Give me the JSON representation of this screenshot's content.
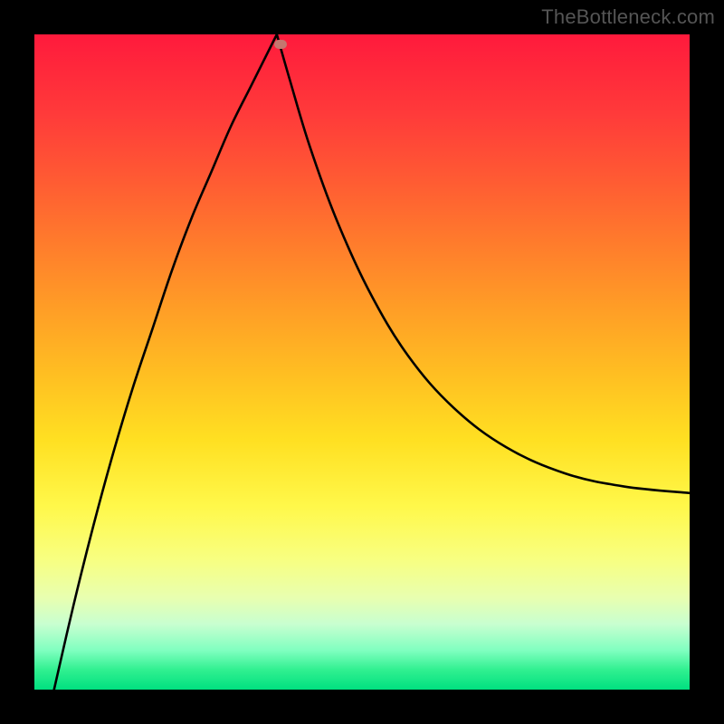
{
  "watermark": "TheBottleneck.com",
  "chart_data": {
    "type": "line",
    "title": "",
    "xlabel": "",
    "ylabel": "",
    "xlim": [
      0,
      1
    ],
    "ylim": [
      0,
      1
    ],
    "vertex_x": 0.37,
    "marker": {
      "x": 0.375,
      "y": 0.985
    },
    "series": [
      {
        "name": "left-branch",
        "x": [
          0.03,
          0.06,
          0.09,
          0.12,
          0.15,
          0.18,
          0.21,
          0.24,
          0.27,
          0.3,
          0.33,
          0.355,
          0.37
        ],
        "y": [
          0.0,
          0.13,
          0.25,
          0.36,
          0.46,
          0.55,
          0.64,
          0.72,
          0.79,
          0.86,
          0.92,
          0.97,
          1.0
        ]
      },
      {
        "name": "right-branch",
        "x": [
          0.37,
          0.39,
          0.42,
          0.46,
          0.51,
          0.57,
          0.64,
          0.72,
          0.81,
          0.9,
          1.0
        ],
        "y": [
          1.0,
          0.93,
          0.83,
          0.72,
          0.61,
          0.51,
          0.43,
          0.37,
          0.33,
          0.31,
          0.3
        ]
      }
    ],
    "colors": {
      "curve": "#000000",
      "marker": "#c4766f",
      "gradient_top": "#ff1a3c",
      "gradient_bottom": "#00e080",
      "frame": "#000000"
    }
  }
}
